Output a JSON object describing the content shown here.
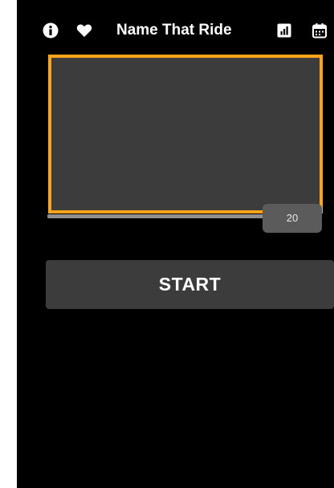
{
  "header": {
    "title": "Name That Ride",
    "icons": [
      "info-icon",
      "heart-icon",
      "stats-icon",
      "calendar-icon"
    ]
  },
  "game": {
    "frame_color": "#ffa31a",
    "frame_background": "#3c3c3c"
  },
  "slider": {
    "value": 20,
    "value_label": "20",
    "fill_fraction": 0.9
  },
  "actions": {
    "start_label": "START"
  },
  "colors": {
    "background": "#000000",
    "accent": "#ffa31a",
    "button": "#3c3c3c",
    "text": "#ffffff"
  }
}
